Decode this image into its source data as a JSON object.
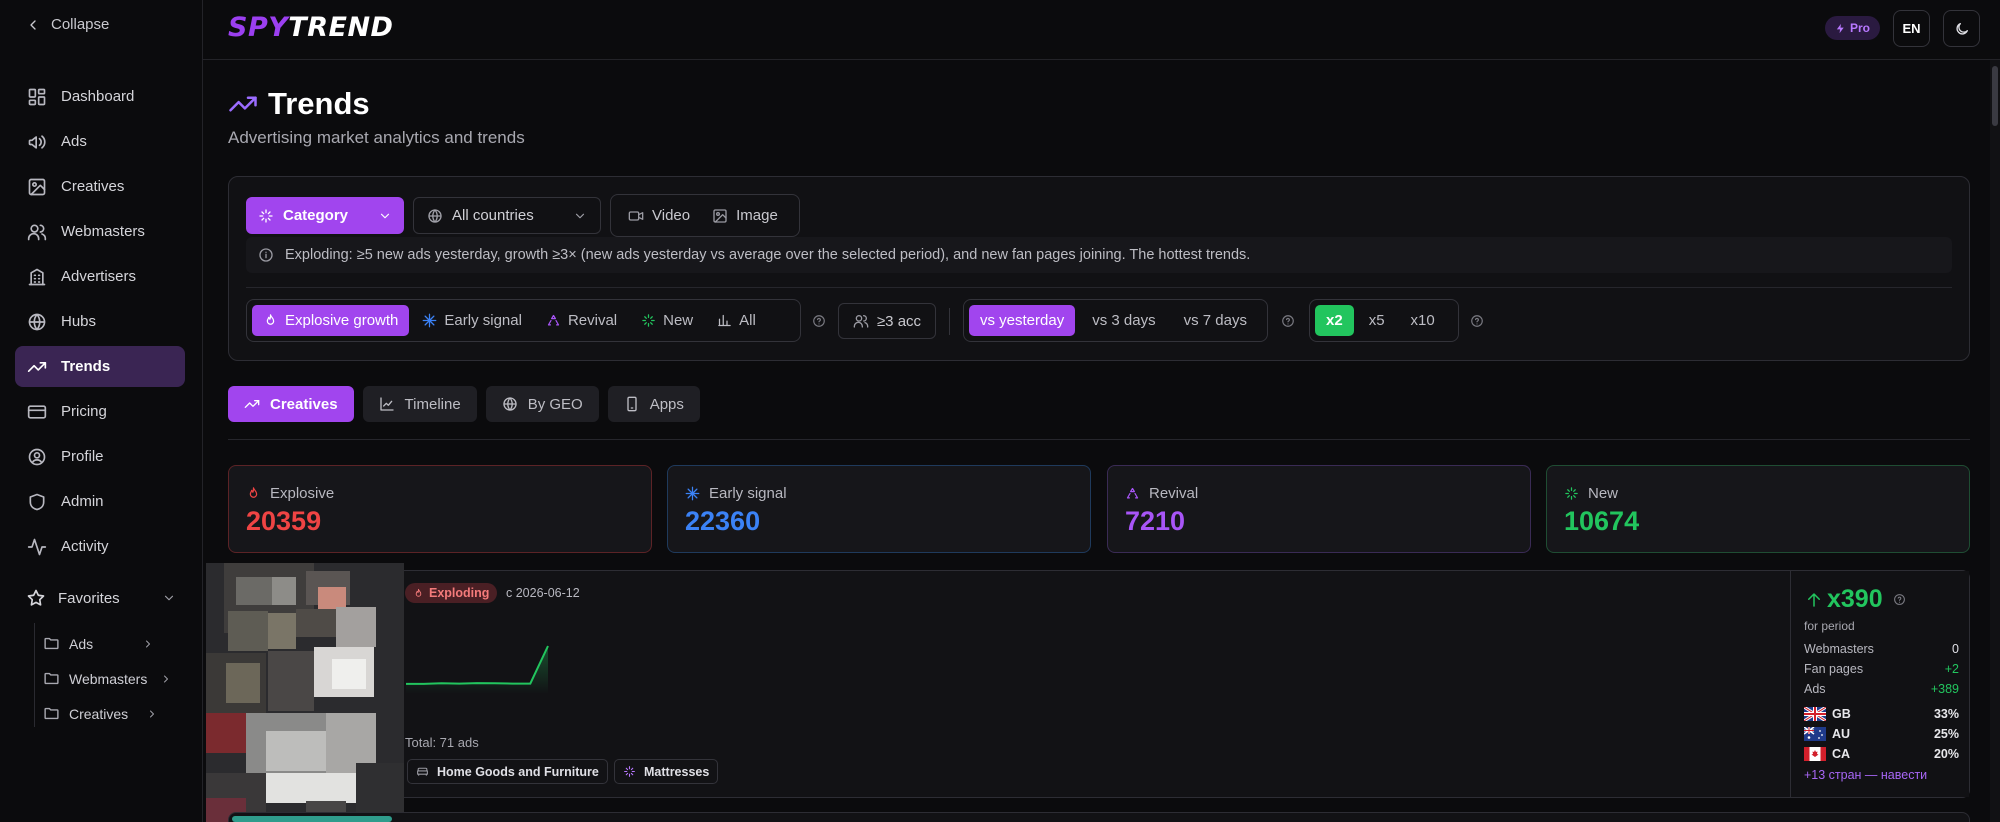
{
  "sidebar": {
    "collapse_label": "Collapse",
    "items": [
      {
        "label": "Dashboard",
        "icon": "dashboard-icon"
      },
      {
        "label": "Ads",
        "icon": "megaphone-icon"
      },
      {
        "label": "Creatives",
        "icon": "image-icon"
      },
      {
        "label": "Webmasters",
        "icon": "users-icon"
      },
      {
        "label": "Advertisers",
        "icon": "building-icon"
      },
      {
        "label": "Hubs",
        "icon": "globe-icon"
      },
      {
        "label": "Trends",
        "icon": "trending-up-icon",
        "active": true
      },
      {
        "label": "Pricing",
        "icon": "credit-card-icon"
      },
      {
        "label": "Profile",
        "icon": "user-icon"
      },
      {
        "label": "Admin",
        "icon": "shield-icon"
      },
      {
        "label": "Activity",
        "icon": "activity-icon"
      }
    ],
    "favorites": {
      "label": "Favorites",
      "items": [
        "Ads",
        "Webmasters",
        "Creatives"
      ]
    }
  },
  "header": {
    "logo_spy": "SPY",
    "logo_trend": "TREND",
    "pro_label": "Pro",
    "lang_label": "EN"
  },
  "page": {
    "title": "Trends",
    "subtitle": "Advertising market analytics and trends"
  },
  "filters": {
    "category_label": "Category",
    "country_label": "All countries",
    "media": [
      "Video",
      "Image"
    ],
    "info_text": "Exploding: ≥5 new ads yesterday, growth ≥3× (new ads yesterday vs average over the selected period), and new fan pages joining. The hottest trends.",
    "signal_types": [
      "Explosive growth",
      "Early signal",
      "Revival",
      "New",
      "All"
    ],
    "signal_active": "Explosive growth",
    "acc_label": "≥3 acc",
    "periods": [
      "vs yesterday",
      "vs 3 days",
      "vs 7 days"
    ],
    "period_active": "vs yesterday",
    "multipliers": [
      "x2",
      "x5",
      "x10"
    ],
    "multiplier_active": "x2"
  },
  "tabs": [
    "Creatives",
    "Timeline",
    "By GEO",
    "Apps"
  ],
  "tab_active": "Creatives",
  "stats": [
    {
      "label": "Explosive",
      "value": "20359",
      "color": "#ef4444",
      "icon": "flame-icon"
    },
    {
      "label": "Early signal",
      "value": "22360",
      "color": "#3b82f6",
      "icon": "spark-icon"
    },
    {
      "label": "Revival",
      "value": "7210",
      "color": "#a855f7",
      "icon": "recycle-icon"
    },
    {
      "label": "New",
      "value": "10674",
      "color": "#22c55e",
      "icon": "sparkles-icon"
    }
  ],
  "trend_card": {
    "badge": "Exploding",
    "since": "с 2026-06-12",
    "sparkline": [
      3,
      3,
      3.2,
      3.1,
      3.3,
      3.2,
      3.1,
      3.1,
      17
    ],
    "total": "Total: 71 ads",
    "tags": [
      "Home Goods and Furniture",
      "Mattresses"
    ],
    "growth": "x390",
    "for_period": "for period",
    "metrics": [
      {
        "label": "Webmasters",
        "value": "0"
      },
      {
        "label": "Fan pages",
        "value": "+2"
      },
      {
        "label": "Ads",
        "value": "+389"
      }
    ],
    "geos": [
      {
        "code": "GB",
        "pct": "33%"
      },
      {
        "code": "AU",
        "pct": "25%"
      },
      {
        "code": "CA",
        "pct": "20%"
      }
    ],
    "more_geos": "+13 стран — навести"
  }
}
